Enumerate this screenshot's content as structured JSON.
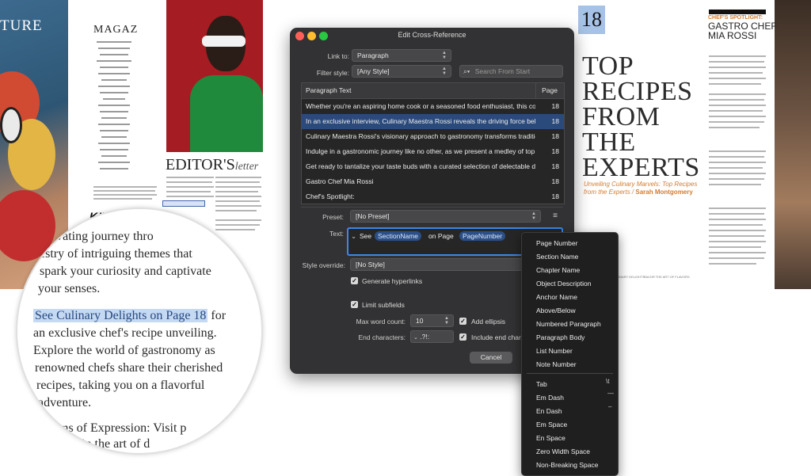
{
  "left_spread": {
    "masthead_fragment": "TURE",
    "toc_title": "MAGAZ",
    "editor_heading": "EDITOR'S",
    "editor_heading_italic": "letter",
    "logo_text": "KIWI"
  },
  "magnifier": {
    "line1": "evating journey thro",
    "line2": "estry of intriguing themes that",
    "line3": "spark your curiosity and captivate",
    "line4": "your senses.",
    "xref_text": "See Culinary Delights on Page 18",
    "line5_rest": " for",
    "line6": "an exclusive chef's recipe unveiling.",
    "line7": "Explore the world of gastronomy as",
    "line8": "renowned chefs share their cherished",
    "line9": "recipes, taking you on a flavorful",
    "line10": "adventure.",
    "line11": "hms of Expression: Visit p",
    "line12": "e in the art of d"
  },
  "dialog": {
    "title": "Edit Cross-Reference",
    "link_to_label": "Link to:",
    "link_to_value": "Paragraph",
    "filter_label": "Filter style:",
    "filter_value": "[Any Style]",
    "search_placeholder": "Search From Start",
    "table": {
      "col_text": "Paragraph Text",
      "col_page": "Page",
      "rows": [
        {
          "text": "Whether you're an aspiring home cook or a seasoned food enthusiast, this colle...",
          "page": "18"
        },
        {
          "text": "In an exclusive interview, Culinary Maestra Rossi reveals the driving force behin...",
          "page": "18"
        },
        {
          "text": "Culinary Maestra Rossi's visionary approach to gastronomy transforms tradition...",
          "page": "18"
        },
        {
          "text": "Indulge in a gastronomic journey like no other, as we present a medley of top re...",
          "page": "18"
        },
        {
          "text": "Get ready to tantalize your taste buds with a curated selection of delectable dis...",
          "page": "18"
        },
        {
          "text": "Gastro Chef  Mia Rossi",
          "page": "18"
        },
        {
          "text": "Chef's Spotlight:",
          "page": "18"
        }
      ]
    },
    "preset_label": "Preset:",
    "preset_value": "[No Preset]",
    "text_label": "Text:",
    "text_see": "See",
    "chip_section": "SectionName",
    "text_on_page": "on Page",
    "chip_page": "PageNumber",
    "style_override_label": "Style override:",
    "style_override_value": "[No Style]",
    "generate_hyperlinks": "Generate hyperlinks",
    "limit_subfields": "Limit subfields",
    "max_word_label": "Max word count:",
    "max_word_value": "10",
    "add_ellipsis": "Add ellipsis",
    "end_chars_label": "End characters:",
    "end_chars_value": ".?!:",
    "include_end_chars": "Include end chara",
    "cancel": "Cancel"
  },
  "popup_menu": {
    "items_group1": [
      "Page Number",
      "Section Name",
      "Chapter Name",
      "Object Description",
      "Anchor Name",
      "Above/Below",
      "Numbered Paragraph",
      "Paragraph Body",
      "List Number",
      "Note Number"
    ],
    "items_group2": [
      "Tab",
      "Em Dash",
      "En Dash",
      "Em Space",
      "En Space",
      "Zero Width Space",
      "Non-Breaking Space"
    ],
    "shortcut_tab": "\\t",
    "shortcut_em": "—",
    "shortcut_en": "–"
  },
  "right_spread": {
    "page_number": "18",
    "title_lines": [
      "TOP",
      "RECIPES",
      "FROM",
      "THE",
      "EXPERTS"
    ],
    "subtitle": "Unveiling Culinary Marvels: Top Recipes from the Experts / ",
    "author": "Sarah Montgomery",
    "spotlight_label": "CHEF'S SPOTLIGHT:",
    "spotlight_name": "GASTRO CHEF MIA ROSSI",
    "footer1": "CULINARY DELIGHTS",
    "footer2": "SAVOR THE ART OF FLAVORS"
  },
  "colors": {
    "selected_row": "#2a4a7c",
    "accent_blue": "#3c86e8",
    "chip_bg": "#2b4f86",
    "xref_highlight": "#c5d9f3",
    "accent_orange": "#d57c2f"
  }
}
